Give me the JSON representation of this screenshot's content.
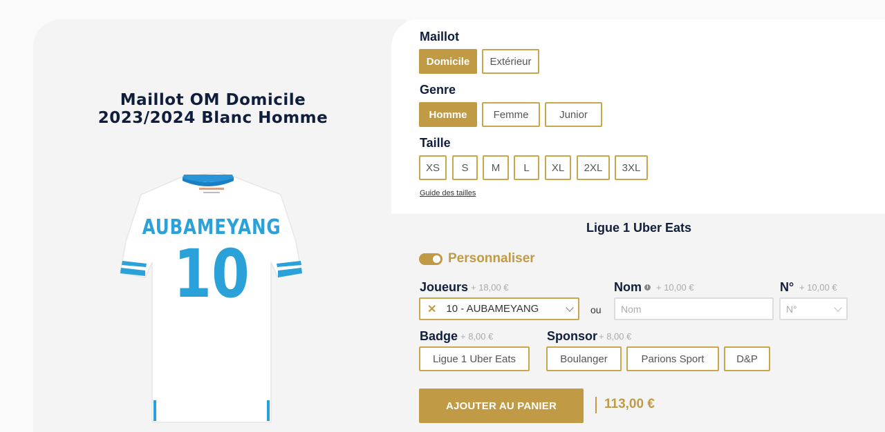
{
  "product": {
    "title_line1": "Maillot OM Domicile",
    "title_line2": "2023/2024 Blanc Homme",
    "jersey_name": "AUBAMEYANG",
    "jersey_number": "10"
  },
  "options": {
    "maillot": {
      "label": "Maillot",
      "choices": [
        "Domicile",
        "Extérieur"
      ],
      "selected": "Domicile"
    },
    "genre": {
      "label": "Genre",
      "choices": [
        "Homme",
        "Femme",
        "Junior"
      ],
      "selected": "Homme"
    },
    "taille": {
      "label": "Taille",
      "choices": [
        "XS",
        "S",
        "M",
        "L",
        "XL",
        "2XL",
        "3XL"
      ],
      "guide_link": "Guide des tailles"
    }
  },
  "customization": {
    "competition": "Ligue 1 Uber Eats",
    "toggle_label": "Personnaliser",
    "joueurs": {
      "label": "Joueurs",
      "price": "+ 18,00 €",
      "value": "10 - AUBAMEYANG",
      "clear_glyph": "✕"
    },
    "ou_text": "ou",
    "nom": {
      "label": "Nom",
      "price": "+ 10,00 €",
      "placeholder": "Nom",
      "info_glyph": "i"
    },
    "numero": {
      "label": "N°",
      "price": "+ 10,00 €",
      "placeholder": "N°"
    },
    "badge": {
      "label": "Badge",
      "price": "+ 8,00 €",
      "options": [
        "Ligue 1 Uber Eats"
      ]
    },
    "sponsor": {
      "label": "Sponsor",
      "price": "+ 8,00 €",
      "options": [
        "Boulanger",
        "Parions Sport",
        "D&P"
      ]
    }
  },
  "cart": {
    "button_label": "AJOUTER AU PANIER",
    "total": "113,00 €"
  },
  "colors": {
    "gold": "#c09a45",
    "navy": "#0f1e3c",
    "jersey_blue": "#2aa1d8"
  }
}
